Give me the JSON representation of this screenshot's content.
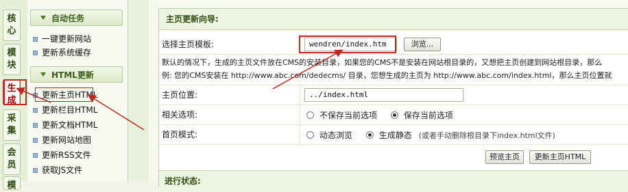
{
  "tabs": [
    "核心",
    "模块",
    "生成",
    "采集",
    "会员",
    "模"
  ],
  "sidebar": {
    "sections": [
      {
        "title": "自动任务",
        "items": [
          "一键更新网站",
          "更新系统缓存"
        ]
      },
      {
        "title": "HTML更新",
        "items": [
          "更新主页HTML",
          "更新栏目HTML",
          "更新文档HTML",
          "更新网站地图",
          "更新RSS文件",
          "获取JS文件"
        ]
      }
    ]
  },
  "panel": {
    "title": "主页更新向导:",
    "template_label": "选择主页模板:",
    "template_value": "wendren/index.htm",
    "browse_label": "浏览...",
    "note_line1": "默认的情况下，生成的主页文件放在CMS的安装目录，如果您的CMS不是安装在网站根目录的，又想把主页创建到网站根目录，那么",
    "note_line2": "例: 您的CMS安装在 http://www.abc.com/dedecms/ 目录，您想生成的主页为 http://www.abc.com/index.html，那么主页位置就",
    "position_label": "主页位置:",
    "position_value": "../index.html",
    "related_label": "相关选项:",
    "related_options": [
      "不保存当前选项",
      "保存当前选项"
    ],
    "related_selected": 1,
    "mode_label": "首页模式:",
    "mode_options": [
      "动态浏览",
      "生成静态"
    ],
    "mode_selected": 1,
    "mode_note": "(或者手动删除根目录下index.html文件)",
    "preview_button": "预览主页",
    "update_button": "更新主页HTML",
    "progress_label": "进行状态:"
  },
  "colors": {
    "annotation": "#c0271f",
    "accent": "#2f4d0e"
  }
}
